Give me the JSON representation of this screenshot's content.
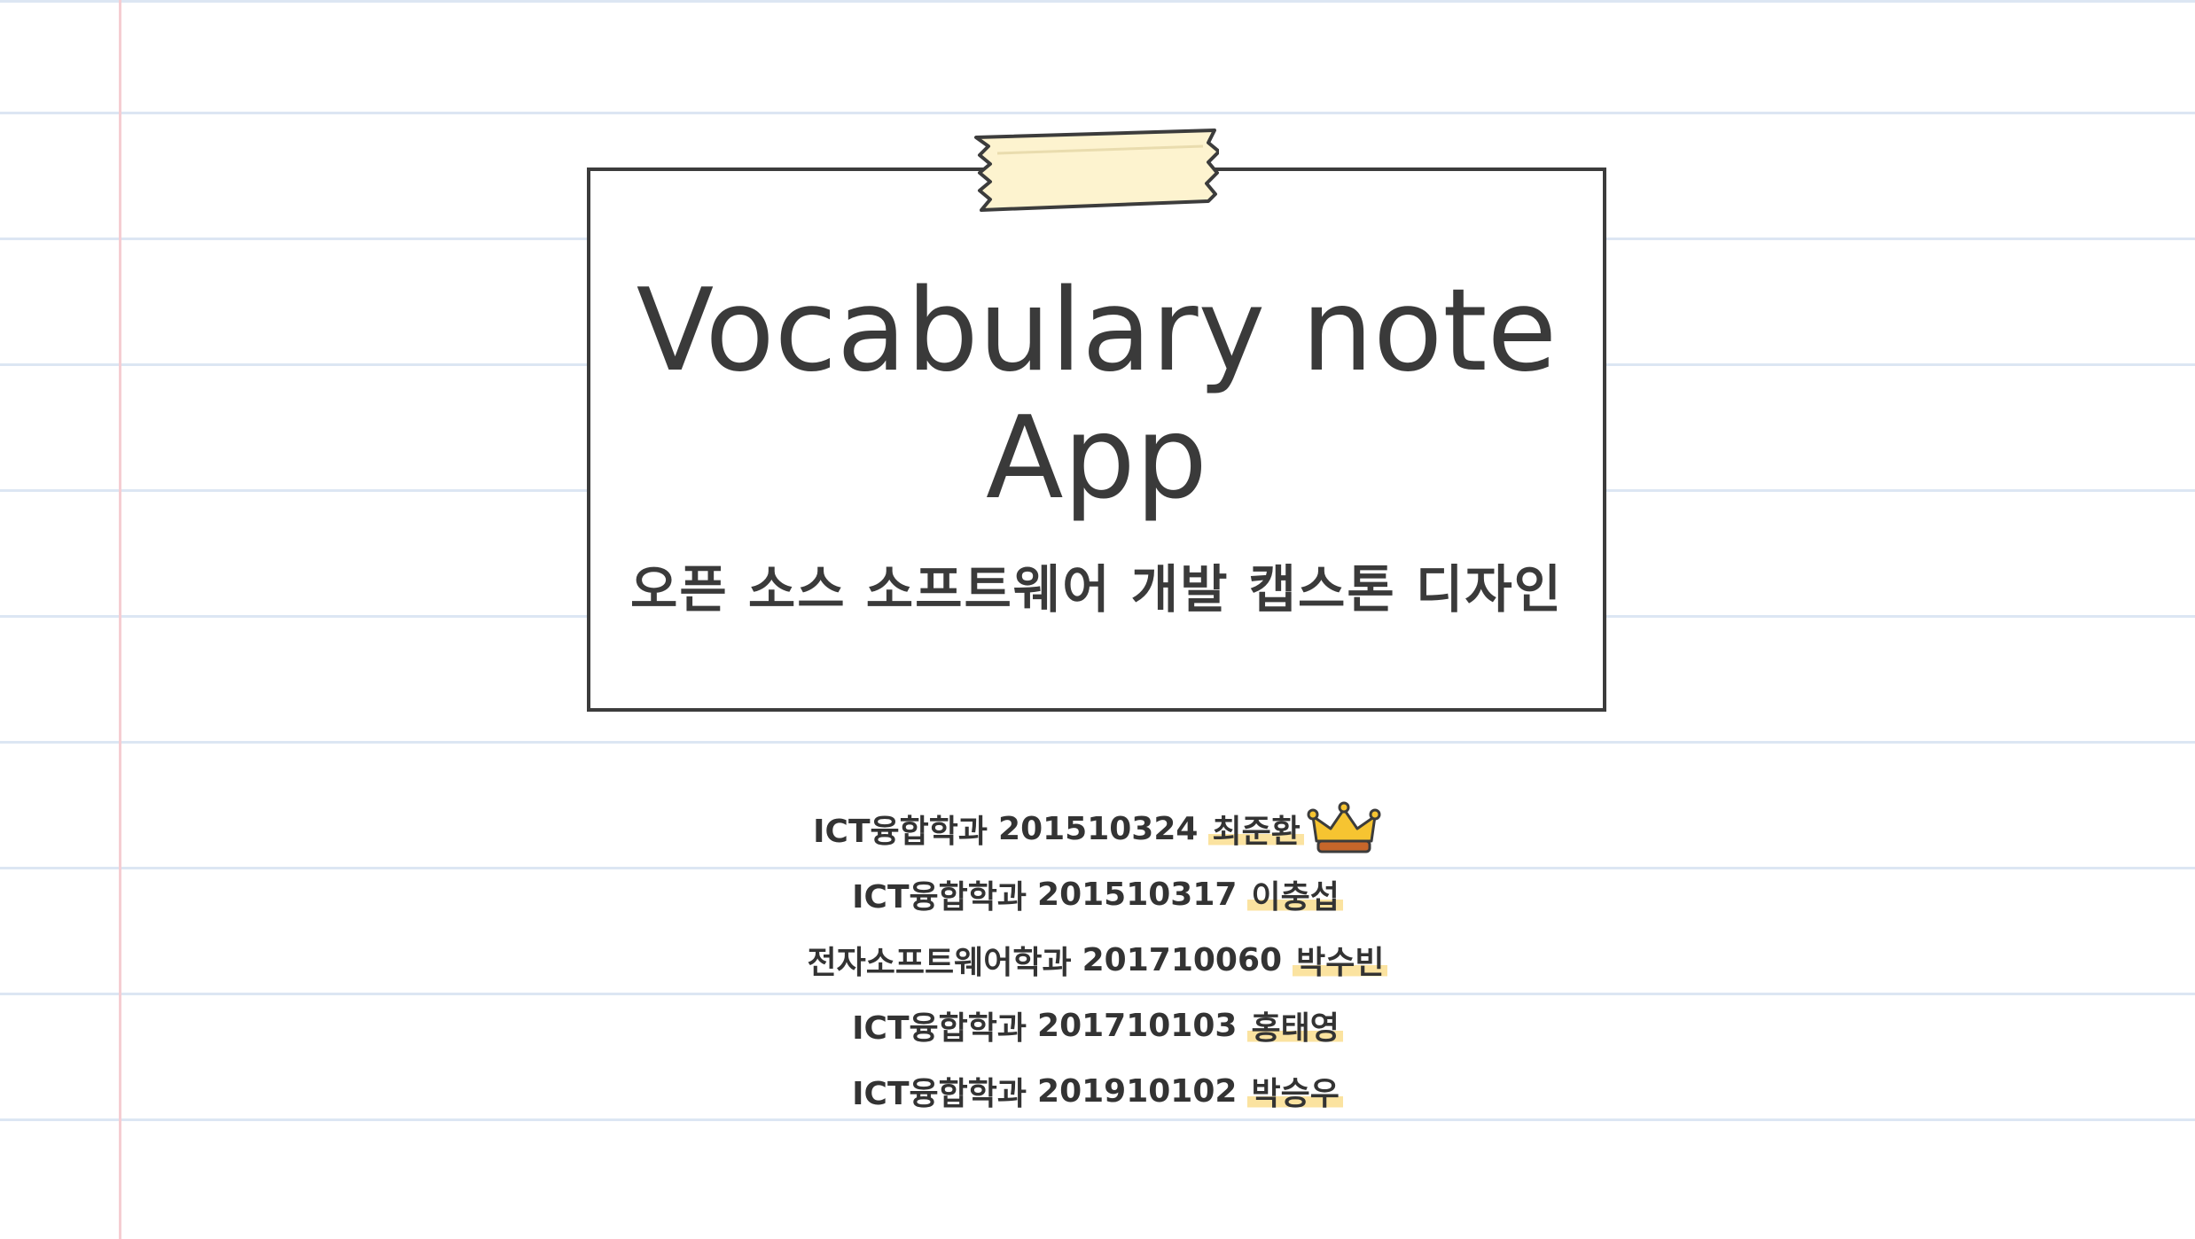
{
  "title": {
    "line1": "Vocabulary note",
    "line2": "App",
    "subtitle": "오픈 소스 소프트웨어 개발 캡스톤 디자인"
  },
  "members": [
    {
      "dept": "ICT융합학과",
      "id": "201510324",
      "name": "최준환",
      "leader": true
    },
    {
      "dept": "ICT융합학과",
      "id": "201510317",
      "name": "이충섭",
      "leader": false
    },
    {
      "dept": "전자소프트웨어학과",
      "id": "201710060",
      "name": "박수빈",
      "leader": false
    },
    {
      "dept": "ICT융합학과",
      "id": "201710103",
      "name": "홍태영",
      "leader": false
    },
    {
      "dept": "ICT융합학과",
      "id": "201910102",
      "name": "박승우",
      "leader": false
    }
  ],
  "icons": {
    "leader_badge": "crown-icon",
    "tape": "masking-tape"
  },
  "colors": {
    "rule": "#dce6f3",
    "margin": "#f5cdd2",
    "highlight": "#fbe3a0",
    "tape": "#fdf3cf",
    "ink": "#3a3a3a"
  }
}
